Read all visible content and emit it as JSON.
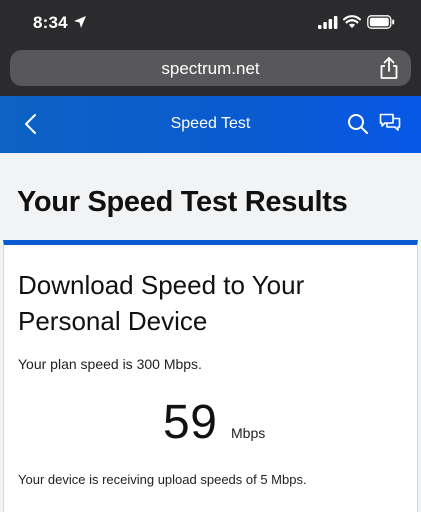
{
  "status_bar": {
    "time": "8:34",
    "icons": [
      "location-arrow-icon",
      "signal-icon",
      "wifi-icon",
      "battery-icon"
    ]
  },
  "browser": {
    "url": "spectrum.net"
  },
  "header": {
    "title": "Speed Test",
    "background_color": "#0a5ad0"
  },
  "page": {
    "title": "Your Speed Test Results"
  },
  "result_card": {
    "title": "Download Speed to Your Personal Device",
    "plan_text": "Your plan speed is 300 Mbps.",
    "speed_value": "59",
    "speed_unit": "Mbps",
    "upload_text": "Your device is receiving upload speeds of 5 Mbps."
  }
}
